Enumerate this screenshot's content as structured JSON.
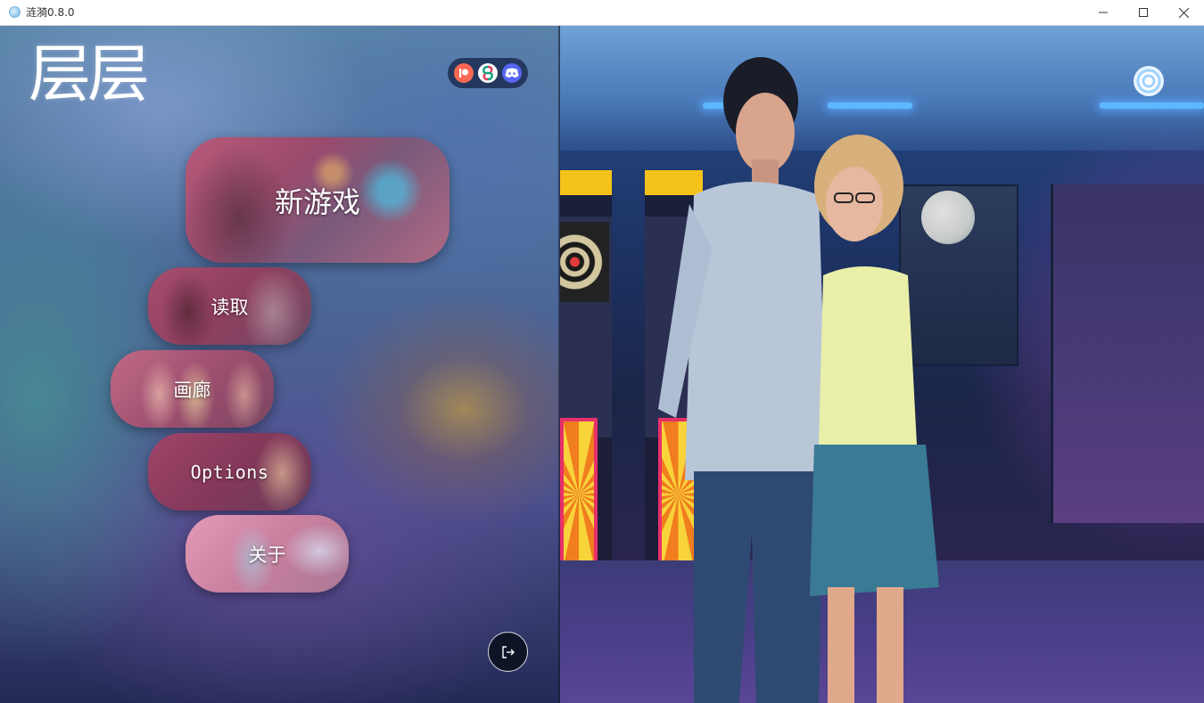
{
  "window": {
    "title": "涟漪0.8.0"
  },
  "game": {
    "logo": "层层"
  },
  "social": {
    "icons": [
      "patreon-icon",
      "subscribestar-icon",
      "discord-icon"
    ]
  },
  "menu": {
    "new_game": "新游戏",
    "load": "读取",
    "gallery": "画廊",
    "options": "Options",
    "about": "关于"
  },
  "colors": {
    "button_accent": "#b85a7a",
    "patreon": "#f96854",
    "discord": "#5865f2",
    "exit_bg": "#0e1426"
  }
}
